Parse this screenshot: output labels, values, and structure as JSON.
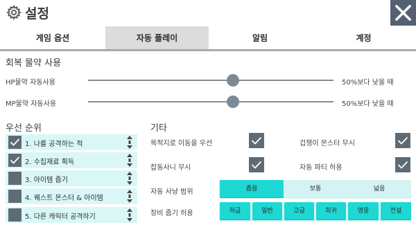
{
  "header": {
    "title": "설정",
    "gear_icon": "gear-icon",
    "close_icon": "close-icon"
  },
  "tabs": [
    {
      "label": "게임 옵션",
      "active": false
    },
    {
      "label": "자동 플레이",
      "active": true
    },
    {
      "label": "알림",
      "active": false
    },
    {
      "label": "계정",
      "active": false
    }
  ],
  "recovery": {
    "title": "회복 물약 사용",
    "hp": {
      "label": "HP물약 자동사용",
      "value_text": "50%보다 낮을 때",
      "level": 0.5
    },
    "mp": {
      "label": "MP물약 자동사용",
      "value_text": "50%보다 낮을 때",
      "level": 0.5
    }
  },
  "priority": {
    "title": "우선 순위",
    "items": [
      {
        "label": "1. 나를 공격하는 적",
        "checked": true
      },
      {
        "label": "2. 수집재료 획득",
        "checked": true
      },
      {
        "label": "3. 아이템 줍기",
        "checked": false
      },
      {
        "label": "4. 퀘스트 몬스터 & 아이템",
        "checked": false
      },
      {
        "label": "5. 다른 캐릭터 공격하기",
        "checked": false
      }
    ]
  },
  "misc": {
    "title": "기타",
    "options": [
      {
        "label": "목적지로 이동을 우선",
        "checked": true
      },
      {
        "label": "겁쟁이 몬스터 무시",
        "checked": true
      },
      {
        "label": "잡동사니 무시",
        "checked": true
      },
      {
        "label": "자동 파티 허용",
        "checked": true
      }
    ],
    "hunt_range": {
      "label": "자동 사냥 범위",
      "options": [
        "좁음",
        "보통",
        "넓음"
      ],
      "selected": "좁음"
    },
    "loot": {
      "label": "장비 줍기 허용",
      "options": [
        "하급",
        "일반",
        "고급",
        "희귀",
        "영웅",
        "전설"
      ],
      "selected": [
        "하급",
        "일반",
        "고급",
        "희귀",
        "영웅",
        "전설"
      ]
    }
  },
  "colors": {
    "accent": "#1ed8d3",
    "panel": "#d9f7f6",
    "dark": "#5f6b74",
    "close_bg": "#546170"
  }
}
